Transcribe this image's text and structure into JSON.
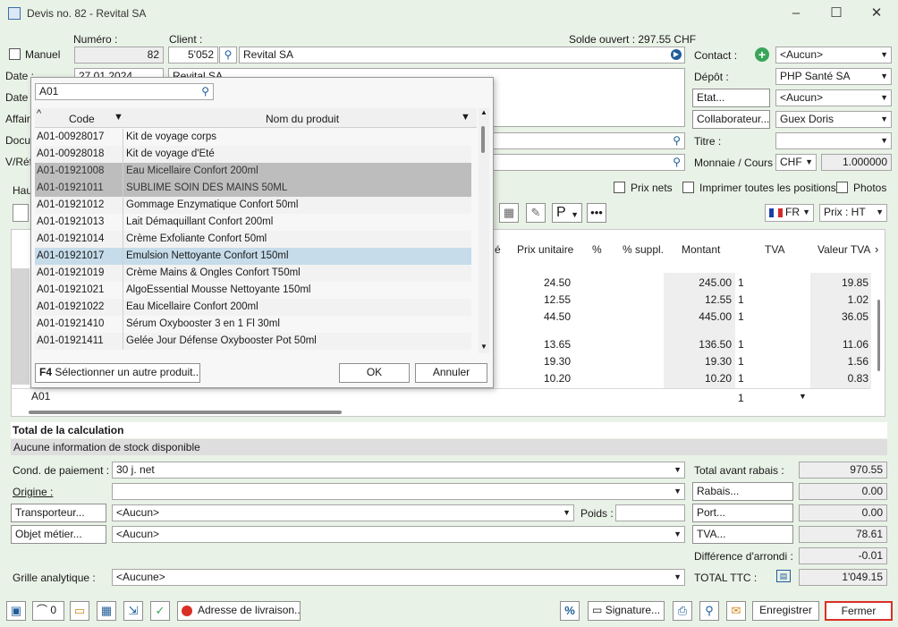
{
  "window": {
    "title": "Devis no. 82 - Revital SA"
  },
  "header": {
    "manuel_label": "Manuel",
    "numero_label": "Numéro :",
    "numero_value": "82",
    "client_label": "Client :",
    "client_code": "5'052",
    "client_name": "Revital SA",
    "solde": "Solde ouvert : 297.55 CHF",
    "date_label": "Date :",
    "date_value": "27.01.2024",
    "date2_label": "Date",
    "client_addr": "Revital SA",
    "affaire_label": "Affair",
    "document_label": "Docur",
    "vref_label": "V/Réf",
    "haut_label": "Hau"
  },
  "right_panel": {
    "contact_label": "Contact :",
    "contact_value": "<Aucun>",
    "depot_label": "Dépôt :",
    "depot_value": "PHP Santé SA",
    "etat_label": "Etat...",
    "etat_value": "<Aucun>",
    "collab_label": "Collaborateur...",
    "collab_value": "Guex Doris",
    "titre_label": "Titre :",
    "titre_value": "",
    "monnaie_label": "Monnaie / Cours :",
    "monnaie_value": "CHF",
    "cours_value": "1.000000",
    "prix_nets": "Prix nets",
    "imprimer_toutes": "Imprimer toutes les positions",
    "photos": "Photos",
    "lang": "FR",
    "prix_mode": "Prix : HT"
  },
  "grid": {
    "columns": [
      "é",
      "Prix unitaire",
      "%",
      "% suppl.",
      "Montant",
      "TVA",
      "Valeur TVA"
    ],
    "rows": [
      {
        "prix": "24.50",
        "montant": "245.00",
        "tva": "1",
        "valeur": "19.85"
      },
      {
        "prix": "12.55",
        "montant": "12.55",
        "tva": "1",
        "valeur": "1.02"
      },
      {
        "prix": "44.50",
        "montant": "445.00",
        "tva": "1",
        "valeur": "36.05"
      },
      {
        "prix": "13.65",
        "montant": "136.50",
        "tva": "1",
        "valeur": "11.06"
      },
      {
        "prix": "19.30",
        "montant": "19.30",
        "tva": "1",
        "valeur": "1.56"
      },
      {
        "prix": "10.20",
        "montant": "10.20",
        "tva": "1",
        "valeur": "0.83"
      }
    ],
    "edit_row_code": "A01",
    "edit_row_tva": "1"
  },
  "popup": {
    "search_value": "A01",
    "col_code": "Code",
    "col_name": "Nom du produit",
    "items": [
      {
        "code": "A01-00928017",
        "name": "Kit de voyage corps",
        "state": "normal"
      },
      {
        "code": "A01-00928018",
        "name": "Kit de voyage d'Eté",
        "state": "alt"
      },
      {
        "code": "A01-01921008",
        "name": "Eau Micellaire Confort 200ml",
        "state": "dis"
      },
      {
        "code": "A01-01921011",
        "name": "SUBLIME SOIN DES MAINS 50ML",
        "state": "dis"
      },
      {
        "code": "A01-01921012",
        "name": "Gommage Enzymatique Confort 50ml",
        "state": "alt"
      },
      {
        "code": "A01-01921013",
        "name": "Lait Démaquillant Confort 200ml",
        "state": "normal"
      },
      {
        "code": "A01-01921014",
        "name": "Crème Exfoliante Confort 50ml",
        "state": "alt"
      },
      {
        "code": "A01-01921017",
        "name": "Emulsion Nettoyante Confort 150ml",
        "state": "sel"
      },
      {
        "code": "A01-01921019",
        "name": "Crème Mains & Ongles Confort T50ml",
        "state": "alt"
      },
      {
        "code": "A01-01921021",
        "name": "AlgoEssential Mousse Nettoyante 150ml",
        "state": "normal"
      },
      {
        "code": "A01-01921022",
        "name": "Eau Micellaire Confort  200ml",
        "state": "alt"
      },
      {
        "code": "A01-01921410",
        "name": "Sérum Oxybooster 3 en 1  Fl 30ml",
        "state": "normal"
      },
      {
        "code": "A01-01921411",
        "name": "Gelée Jour Défense Oxybooster Pot 50ml",
        "state": "alt"
      }
    ],
    "f4_key": "F4",
    "f4_label": "Sélectionner un autre produit...",
    "ok": "OK",
    "annuler": "Annuler"
  },
  "totals_section": {
    "title": "Total de la calculation",
    "stock_info": "Aucune information de stock disponible"
  },
  "lower": {
    "cond_label": "Cond. de paiement :",
    "cond_value": "30 j. net",
    "origine_label": "Origine :",
    "origine_value": "",
    "transporteur_label": "Transporteur...",
    "transporteur_value": "<Aucun>",
    "poids_label": "Poids :",
    "poids_value": "",
    "objet_label": "Objet métier...",
    "objet_value": "<Aucun>",
    "grille_label": "Grille analytique :",
    "grille_value": "<Aucune>"
  },
  "summary": {
    "total_avant_label": "Total avant rabais :",
    "total_avant": "970.55",
    "rabais_label": "Rabais...",
    "rabais": "0.00",
    "port_label": "Port...",
    "port": "0.00",
    "tva_label": "TVA...",
    "tva": "78.61",
    "diff_label": "Différence d'arrondi :",
    "diff": "-0.01",
    "ttc_label": "TOTAL TTC :",
    "ttc": "1'049.15"
  },
  "bottom": {
    "attachments_count": "0",
    "adresse": "Adresse de livraison...",
    "signature": "Signature...",
    "enregistrer": "Enregistrer",
    "fermer": "Fermer"
  },
  "colors": {
    "background": "#e9f2e6",
    "selected_row": "#c6dcea",
    "disabled_row": "#bdbdbd",
    "fermer_border": "#d93025",
    "adresse_dot": "#d93025",
    "contact_add": "#3aa55a"
  }
}
